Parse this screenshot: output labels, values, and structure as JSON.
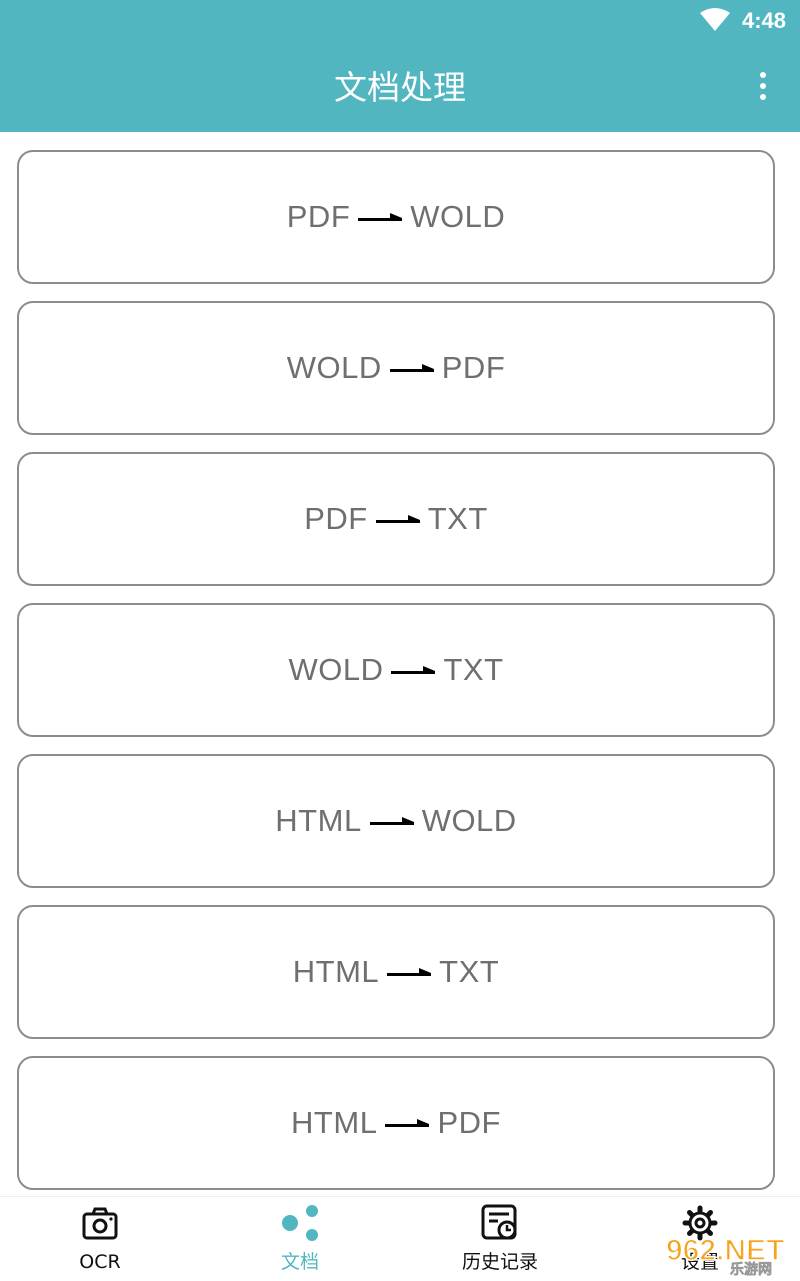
{
  "status_bar": {
    "time": "4:48",
    "wifi_icon": "wifi-icon"
  },
  "header": {
    "title": "文档处理",
    "menu_icon": "more-vert-icon"
  },
  "conversions": [
    {
      "from": "PDF",
      "to": "WOLD"
    },
    {
      "from": "WOLD",
      "to": "PDF"
    },
    {
      "from": "PDF",
      "to": "TXT"
    },
    {
      "from": "WOLD",
      "to": "TXT"
    },
    {
      "from": "HTML",
      "to": "WOLD"
    },
    {
      "from": "HTML",
      "to": "TXT"
    },
    {
      "from": "HTML",
      "to": "PDF"
    }
  ],
  "bottom_nav": {
    "items": [
      {
        "label": "OCR",
        "icon": "camera-icon",
        "active": false
      },
      {
        "label": "文档",
        "icon": "dots-icon",
        "active": true
      },
      {
        "label": "历史记录",
        "icon": "history-icon",
        "active": false
      },
      {
        "label": "设置",
        "icon": "gear-icon",
        "active": false
      }
    ]
  },
  "watermark": {
    "text": "962.NET",
    "subtext": "乐游网"
  },
  "colors": {
    "accent": "#52b6c1",
    "card_border": "#8c8c8c",
    "card_text": "#6f6f6f"
  }
}
